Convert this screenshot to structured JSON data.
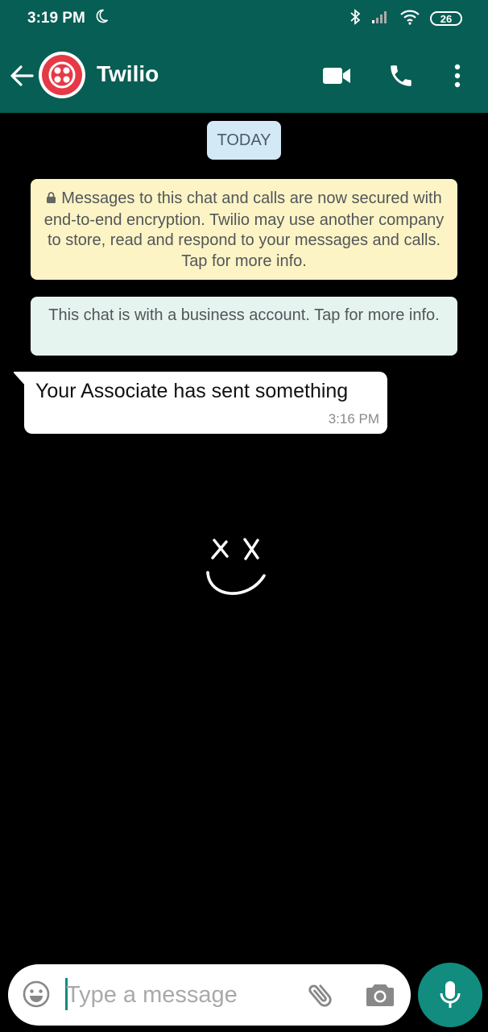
{
  "status_bar": {
    "time": "3:19 PM",
    "battery": "26",
    "icons": [
      "moon-icon",
      "bluetooth-icon",
      "signal-icon",
      "wifi-icon",
      "battery-icon"
    ]
  },
  "header": {
    "contact_name": "Twilio",
    "icons": [
      "back-arrow-icon",
      "video-call-icon",
      "phone-icon",
      "more-vert-icon"
    ]
  },
  "chat": {
    "date_label": "TODAY",
    "encryption_notice": "Messages to this chat and calls are now secured with end-to-end encryption. Twilio may use another company to store, read and respond to your messages and calls. Tap for more info.",
    "business_notice": "This chat is with a business account. Tap for more info.",
    "messages": [
      {
        "text": "Your Associate has sent something",
        "time": "3:16 PM"
      }
    ]
  },
  "composer": {
    "placeholder": "Type a message",
    "icons": [
      "emoji-icon",
      "attach-icon",
      "camera-icon",
      "mic-icon"
    ]
  },
  "colors": {
    "header": "#075e54",
    "accent": "#128c7e",
    "encryption_bg": "#fdf4c5",
    "business_bg": "#e6f4ef",
    "date_chip_bg": "#d4e9f6",
    "chat_bg": "#000000"
  }
}
